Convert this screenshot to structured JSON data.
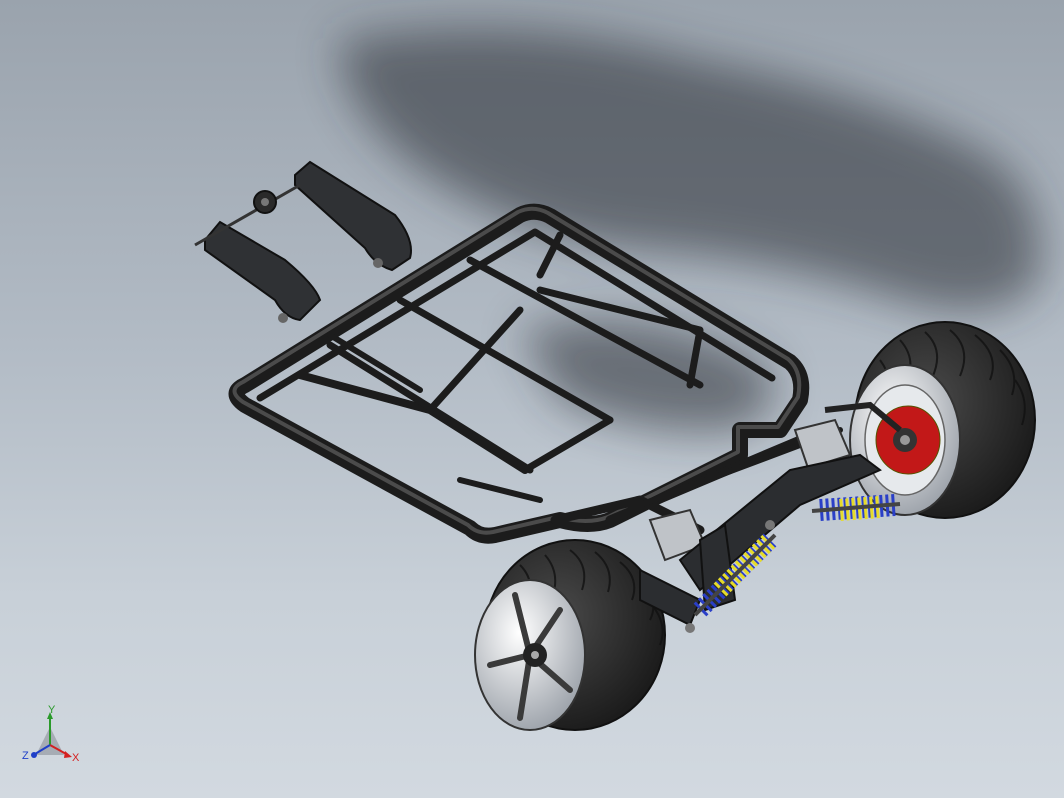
{
  "triad": {
    "x_label": "X",
    "y_label": "Y",
    "z_label": "Z",
    "x_color": "#d42020",
    "y_color": "#2a9a2a",
    "z_color": "#1f3fc8"
  },
  "colors": {
    "frame": "#1c1c1c",
    "tire": "#2b2b2b",
    "rim": "#d9dde2",
    "spring_yellow": "#e6dc2a",
    "spring_blue": "#2a3fc8",
    "brake": "#c21818",
    "motor": "#bfc3c8"
  }
}
